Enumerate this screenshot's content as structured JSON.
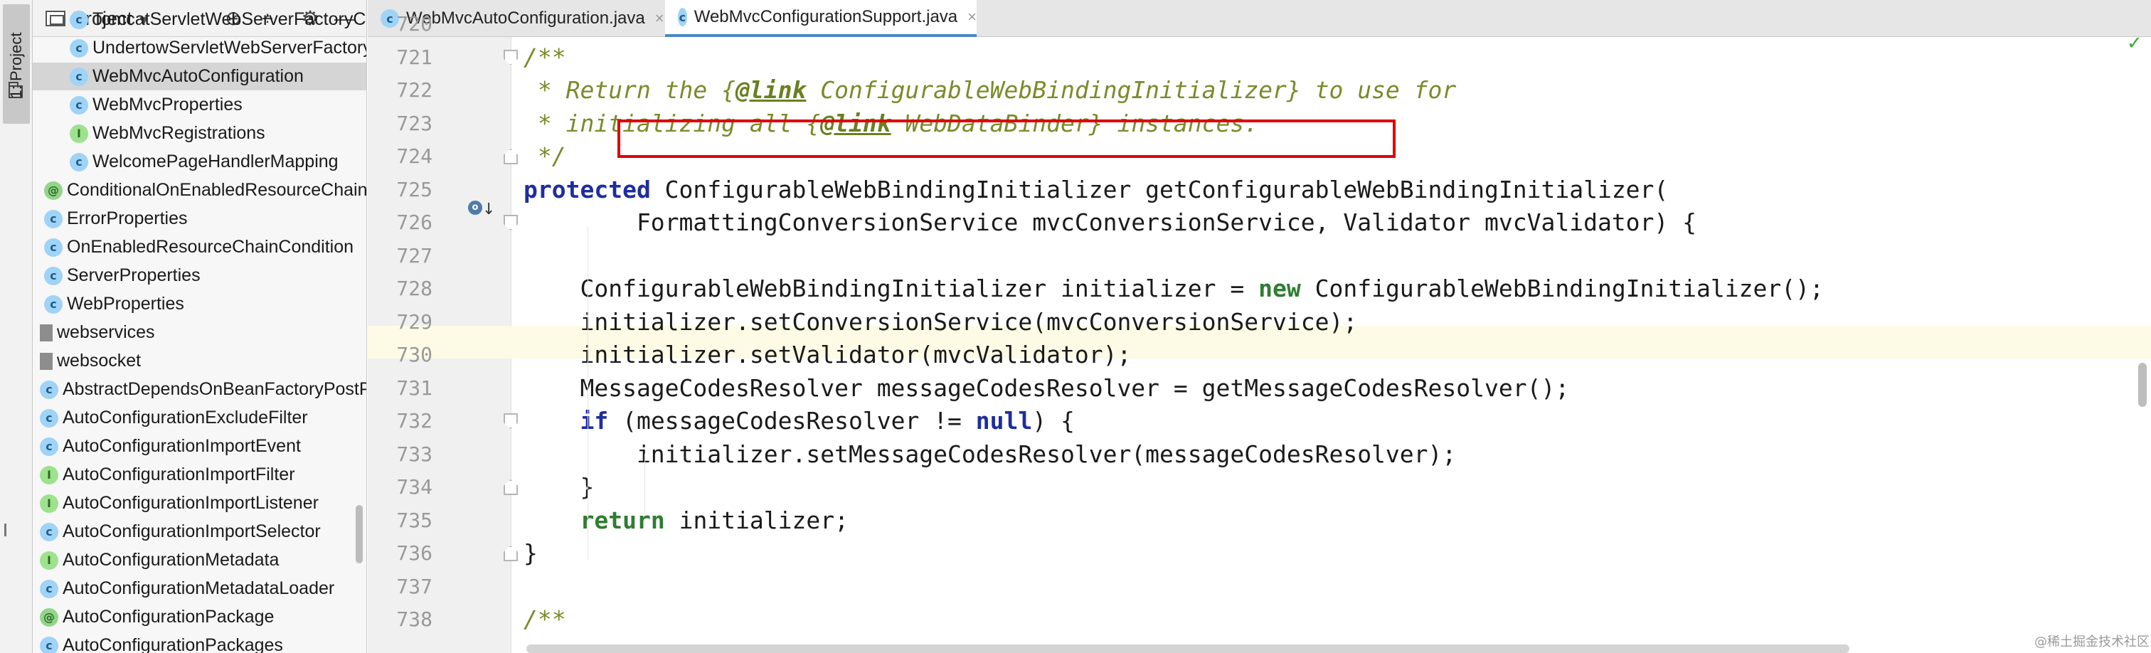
{
  "tool_strip": {
    "label": "1: Project"
  },
  "project_panel": {
    "title": "Project",
    "chevron": "▾",
    "buttons": [
      "⊕",
      "÷",
      "⚙",
      "—"
    ],
    "tree": [
      {
        "label": "TomcatServletWebServerFactoryCustomizer",
        "kind": "class",
        "indent": 1
      },
      {
        "label": "UndertowServletWebServerFactoryCustomizer",
        "kind": "class",
        "indent": 1
      },
      {
        "label": "WebMvcAutoConfiguration",
        "kind": "class",
        "indent": 1,
        "selected": true
      },
      {
        "label": "WebMvcProperties",
        "kind": "class",
        "indent": 1
      },
      {
        "label": "WebMvcRegistrations",
        "kind": "interface",
        "indent": 1
      },
      {
        "label": "WelcomePageHandlerMapping",
        "kind": "class",
        "indent": 1
      },
      {
        "label": "ConditionalOnEnabledResourceChain",
        "kind": "annotation",
        "indent": 0
      },
      {
        "label": "ErrorProperties",
        "kind": "class",
        "indent": 0
      },
      {
        "label": "OnEnabledResourceChainCondition",
        "kind": "class",
        "indent": 0
      },
      {
        "label": "ServerProperties",
        "kind": "class",
        "indent": 0
      },
      {
        "label": "WebProperties",
        "kind": "class",
        "indent": 0
      },
      {
        "label": "webservices",
        "kind": "package",
        "indent": -1
      },
      {
        "label": "websocket",
        "kind": "package",
        "indent": -1
      },
      {
        "label": "AbstractDependsOnBeanFactoryPostProcessor",
        "kind": "class",
        "indent": -1
      },
      {
        "label": "AutoConfigurationExcludeFilter",
        "kind": "class",
        "indent": -1
      },
      {
        "label": "AutoConfigurationImportEvent",
        "kind": "class",
        "indent": -1
      },
      {
        "label": "AutoConfigurationImportFilter",
        "kind": "interface",
        "indent": -1
      },
      {
        "label": "AutoConfigurationImportListener",
        "kind": "interface",
        "indent": -1
      },
      {
        "label": "AutoConfigurationImportSelector",
        "kind": "class",
        "indent": -1
      },
      {
        "label": "AutoConfigurationMetadata",
        "kind": "interface",
        "indent": -1
      },
      {
        "label": "AutoConfigurationMetadataLoader",
        "kind": "class",
        "indent": -1
      },
      {
        "label": "AutoConfigurationPackage",
        "kind": "annotation",
        "indent": -1
      },
      {
        "label": "AutoConfigurationPackages",
        "kind": "class",
        "indent": -1
      }
    ]
  },
  "tabs": [
    {
      "label": "WebMvcAutoConfiguration.java",
      "active": false,
      "close": "×"
    },
    {
      "label": "WebMvcConfigurationSupport.java",
      "active": true,
      "close": "×"
    }
  ],
  "editor": {
    "current_line": "729",
    "status_check": "✓",
    "lines": [
      {
        "no": "720",
        "tokens": [
          {
            "t": "",
            "c": ""
          }
        ]
      },
      {
        "no": "721",
        "indent": 0,
        "tokens": [
          {
            "t": "/**",
            "c": "comment"
          }
        ]
      },
      {
        "no": "722",
        "indent": 0,
        "tokens": [
          {
            "t": " * Return the {",
            "c": "comment"
          },
          {
            "t": "@link",
            "c": "tag"
          },
          {
            "t": " ConfigurableWebBindingInitializer} to use for",
            "c": "comment"
          }
        ]
      },
      {
        "no": "723",
        "indent": 0,
        "tokens": [
          {
            "t": " * initializing all {",
            "c": "comment"
          },
          {
            "t": "@link",
            "c": "tag"
          },
          {
            "t": " WebDataBinder} instances.",
            "c": "comment"
          }
        ]
      },
      {
        "no": "724",
        "indent": 0,
        "tokens": [
          {
            "t": " */",
            "c": "comment"
          }
        ]
      },
      {
        "no": "725",
        "indent": 0,
        "tokens": [
          {
            "t": "protected",
            "c": "kw"
          },
          {
            "t": " ConfigurableWebBindingInitializer getConfigurableWebBindingInitializer(",
            "c": ""
          }
        ]
      },
      {
        "no": "726",
        "indent": 0,
        "tokens": [
          {
            "t": "        FormattingConversionService mvcConversionService, Validator mvcValidator) {",
            "c": ""
          }
        ]
      },
      {
        "no": "727",
        "indent": 0,
        "tokens": [
          {
            "t": "",
            "c": ""
          }
        ]
      },
      {
        "no": "728",
        "indent": 0,
        "tokens": [
          {
            "t": "    ConfigurableWebBindingInitializer initializer = ",
            "c": ""
          },
          {
            "t": "new",
            "c": "kw-green"
          },
          {
            "t": " ConfigurableWebBindingInitializer();",
            "c": ""
          }
        ]
      },
      {
        "no": "729",
        "indent": 0,
        "tokens": [
          {
            "t": "    initializer.setConversionService(mvcConversionService);",
            "c": ""
          }
        ]
      },
      {
        "no": "730",
        "indent": 0,
        "tokens": [
          {
            "t": "    initializer.setValidator(mvcValidator);",
            "c": ""
          }
        ]
      },
      {
        "no": "731",
        "indent": 0,
        "tokens": [
          {
            "t": "    MessageCodesResolver messageCodesResolver = getMessageCodesResolver();",
            "c": ""
          }
        ]
      },
      {
        "no": "732",
        "indent": 0,
        "tokens": [
          {
            "t": "    ",
            "c": ""
          },
          {
            "t": "if",
            "c": "kw"
          },
          {
            "t": " (messageCodesResolver != ",
            "c": ""
          },
          {
            "t": "null",
            "c": "kw"
          },
          {
            "t": ") {",
            "c": ""
          }
        ]
      },
      {
        "no": "733",
        "indent": 0,
        "tokens": [
          {
            "t": "        initializer.setMessageCodesResolver(messageCodesResolver);",
            "c": ""
          }
        ]
      },
      {
        "no": "734",
        "indent": 0,
        "tokens": [
          {
            "t": "    }",
            "c": ""
          }
        ]
      },
      {
        "no": "735",
        "indent": 0,
        "tokens": [
          {
            "t": "    ",
            "c": ""
          },
          {
            "t": "return",
            "c": "kw-green"
          },
          {
            "t": " initializer;",
            "c": ""
          }
        ]
      },
      {
        "no": "736",
        "indent": 0,
        "tokens": [
          {
            "t": "}",
            "c": ""
          }
        ]
      },
      {
        "no": "737",
        "indent": 0,
        "tokens": [
          {
            "t": "",
            "c": ""
          }
        ]
      },
      {
        "no": "738",
        "indent": 0,
        "tokens": [
          {
            "t": "/**",
            "c": "comment"
          }
        ]
      }
    ]
  },
  "watermark": "@稀土掘金技术社区"
}
